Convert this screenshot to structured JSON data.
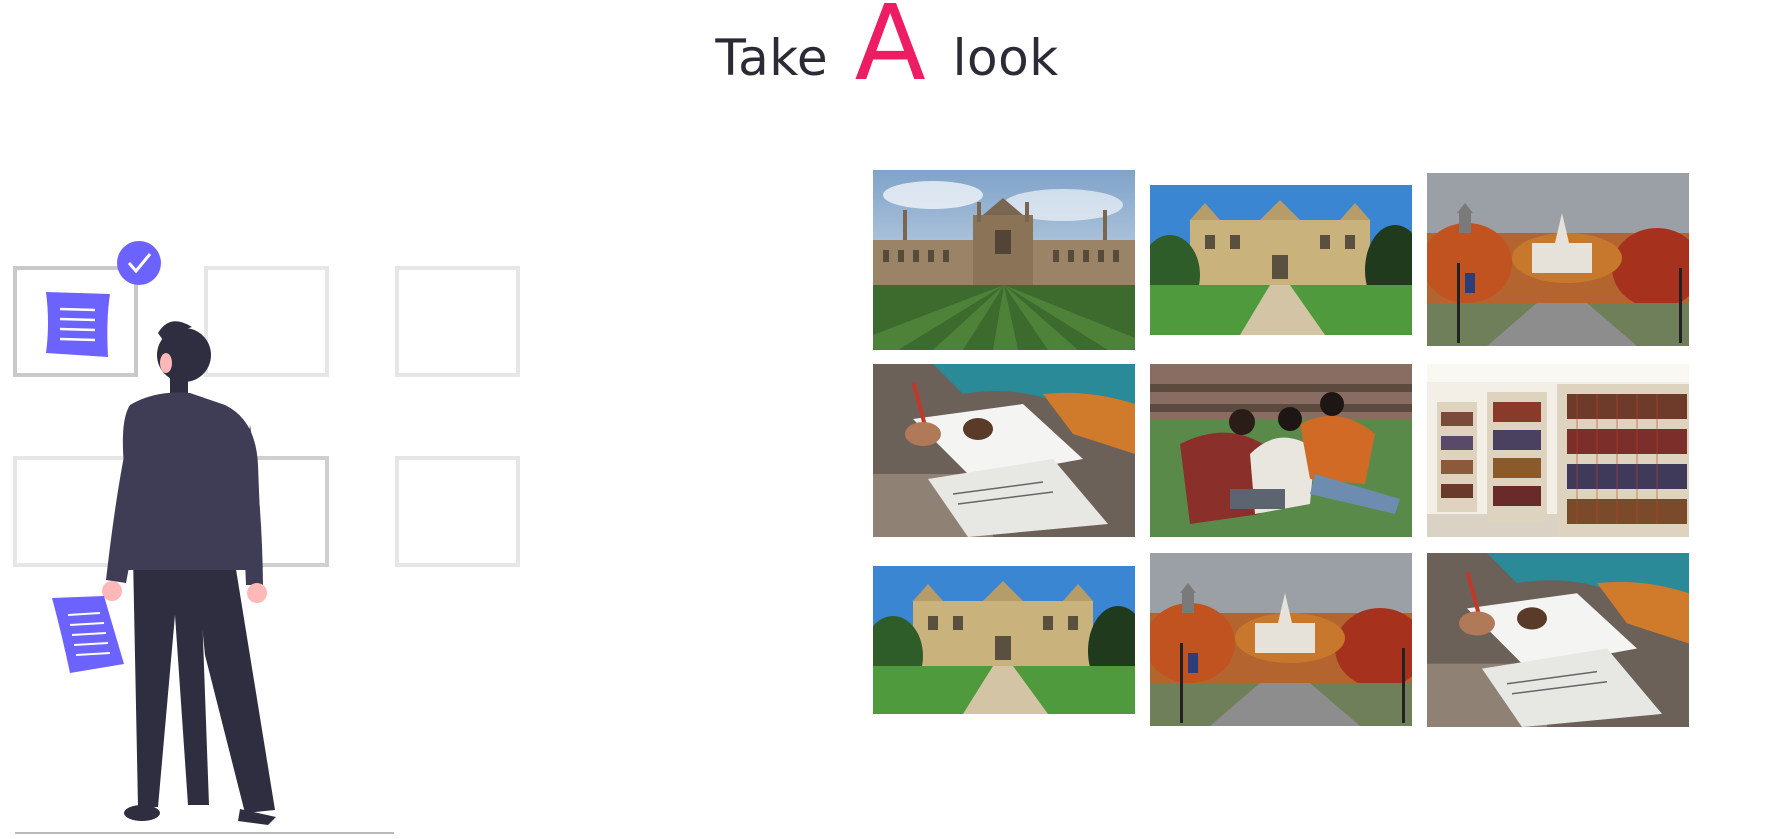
{
  "heading": {
    "part1": "Take",
    "accent": "A",
    "part2": "look"
  },
  "colors": {
    "accent": "#ee1d63",
    "illustration_purple": "#6c63ff",
    "dark": "#2b2a35"
  },
  "illustration": {
    "label": "person-reviewing-documents"
  },
  "gallery": {
    "images": [
      {
        "scene": "gothic-college-lawn"
      },
      {
        "scene": "manor-house-path"
      },
      {
        "scene": "autumn-campus-chapel"
      },
      {
        "scene": "students-writing-notes"
      },
      {
        "scene": "students-on-grass"
      },
      {
        "scene": "library-bookshelves"
      },
      {
        "scene": "manor-house-path"
      },
      {
        "scene": "autumn-campus-chapel"
      },
      {
        "scene": "students-writing-notes"
      }
    ]
  }
}
